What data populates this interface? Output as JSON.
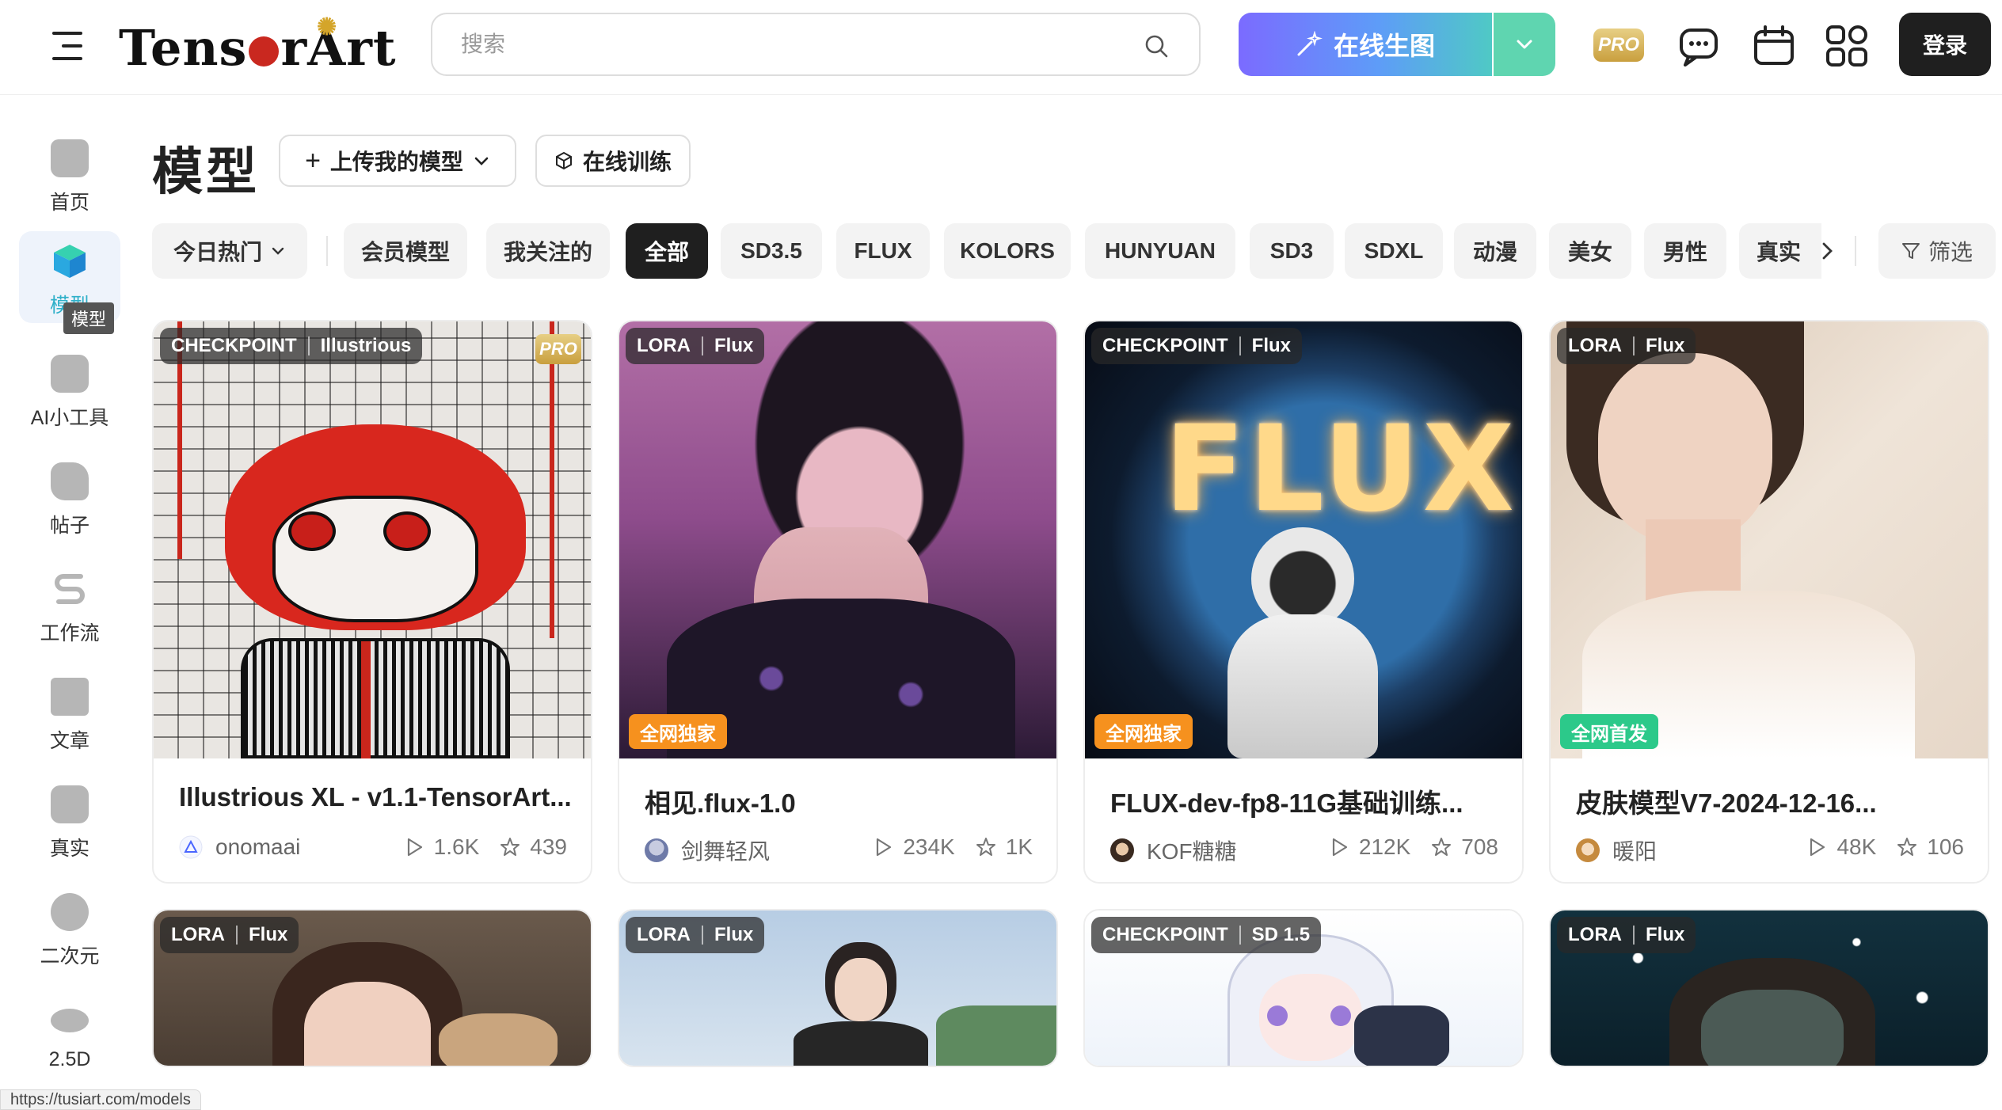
{
  "brand": {
    "logo_text": "TensorArt"
  },
  "search": {
    "placeholder": "搜索"
  },
  "header": {
    "generate_label": "在线生图",
    "pro_label": "PRO",
    "login_label": "登录"
  },
  "sidebar": {
    "items": [
      {
        "label": "首页",
        "icon": "home-icon"
      },
      {
        "label": "模型",
        "icon": "model-cube-icon",
        "active": true
      },
      {
        "label": "AI小工具",
        "icon": "ai-tools-icon"
      },
      {
        "label": "帖子",
        "icon": "posts-icon"
      },
      {
        "label": "工作流",
        "icon": "workflow-icon"
      },
      {
        "label": "文章",
        "icon": "article-icon"
      },
      {
        "label": "真实",
        "icon": "camera-icon"
      },
      {
        "label": "二次元",
        "icon": "anime-icon"
      },
      {
        "label": "2.5D",
        "icon": "ufo-icon"
      }
    ],
    "tooltip": "模型"
  },
  "page": {
    "title": "模型",
    "upload_label": "上传我的模型",
    "train_label": "在线训练"
  },
  "filters": {
    "sort_label": "今日热门",
    "chips": [
      "会员模型",
      "我关注的",
      "全部",
      "SD3.5",
      "FLUX",
      "KOLORS",
      "HUNYUAN",
      "SD3",
      "SDXL",
      "动漫",
      "美女",
      "男性",
      "真实"
    ],
    "active_chip": "全部",
    "filter_label": "筛选"
  },
  "cards": [
    {
      "type": "CHECKPOINT",
      "base": "Illustrious",
      "pro": "PRO",
      "title": "Illustrious XL - v1.1-TensorArt...",
      "author": "onomaai",
      "runs": "1.6K",
      "stars": "439"
    },
    {
      "type": "LORA",
      "base": "Flux",
      "badge": "全网独家",
      "title": "相见.flux-1.0",
      "author": "剑舞轻风",
      "runs": "234K",
      "stars": "1K"
    },
    {
      "type": "CHECKPOINT",
      "base": "Flux",
      "badge": "全网独家",
      "title": "FLUX-dev-fp8-11G基础训练...",
      "author": "KOF糖糖",
      "runs": "212K",
      "stars": "708",
      "overlay_text": "FLUX"
    },
    {
      "type": "LORA",
      "base": "Flux",
      "badge": "全网首发",
      "title": "皮肤模型V7-2024-12-16...",
      "author": "暖阳",
      "runs": "48K",
      "stars": "106"
    },
    {
      "type": "LORA",
      "base": "Flux"
    },
    {
      "type": "LORA",
      "base": "Flux"
    },
    {
      "type": "CHECKPOINT",
      "base": "SD 1.5"
    },
    {
      "type": "LORA",
      "base": "Flux"
    }
  ],
  "status_bar": {
    "url": "https://tusiart.com/models"
  },
  "colors": {
    "accent": "#2fb0c9",
    "orange_badge": "#f6911e",
    "green_badge": "#2cc98a",
    "dark": "#1f1f1f"
  }
}
